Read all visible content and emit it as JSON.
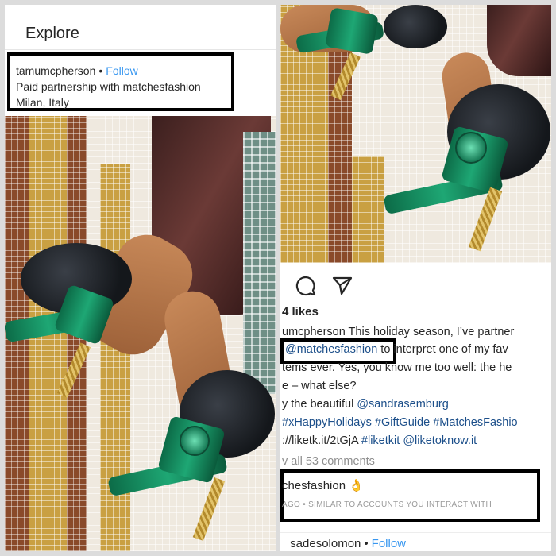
{
  "left": {
    "explore_title": "Explore",
    "post_header": {
      "username": "tamumcpherson",
      "separator": "•",
      "follow_label": "Follow",
      "partnership_prefix": "Paid partnership with ",
      "partner": "matchesfashion",
      "location": "Milan, Italy"
    }
  },
  "right": {
    "likes": "4 likes",
    "caption": {
      "line1": "umcpherson This holiday season, I’ve partner",
      "line2_mention": "@matchesfashion",
      "line2_rest": " to interpret one of my fav",
      "line3": "tems ever. Yes, you know me too well: the he",
      "line4": "e – what else?",
      "line5_prefix": "y the beautiful ",
      "line5_mention": "@sandrasemburg",
      "line6_a": "#xHappyHolidays",
      "line6_b": "#GiftGuide",
      "line6_c": "#MatchesFashio",
      "line7_prefix": "://liketk.it/2tGjA ",
      "line7_a": "#liketkit",
      "line7_b": "@liketoknow.it"
    },
    "view_comments": "v all 53 comments",
    "suggestion": {
      "account": "chesfashion",
      "emoji": "👌",
      "meta": "AGO • SIMILAR TO ACCOUNTS YOU INTERACT WITH"
    },
    "next_post": {
      "username": "sadesolomon",
      "separator": "•",
      "follow_label": "Follow"
    }
  },
  "colors": {
    "link_blue": "#3897f0",
    "tag_blue": "#1c4f8a",
    "muted_gray": "#8e8e8e"
  },
  "icons": [
    "comment-icon",
    "share-icon"
  ]
}
